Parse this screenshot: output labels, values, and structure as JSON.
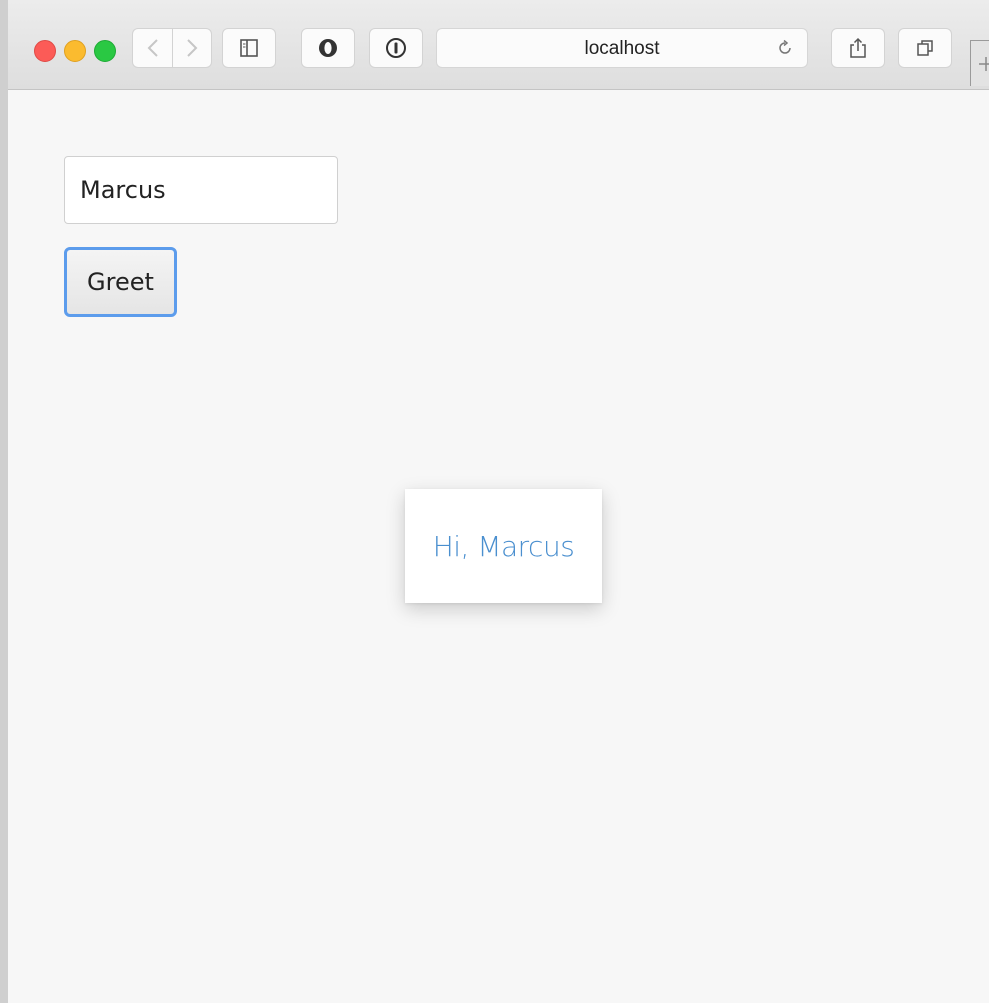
{
  "browser": {
    "address": "localhost",
    "traffic_lights": {
      "close": "#fc5b57",
      "minimize": "#fbbb2f",
      "maximize": "#2ac843"
    },
    "toolbar_icons": [
      "back-icon",
      "forward-icon",
      "sidebar-icon",
      "opera-icon",
      "info-icon",
      "reload-icon",
      "share-icon",
      "tabs-icon",
      "plus-icon"
    ]
  },
  "page": {
    "name_input": {
      "value": "Marcus"
    },
    "greet_button": {
      "label": "Greet"
    },
    "greeting": {
      "text": "Hi, Marcus",
      "color": "#4a8fcf"
    }
  }
}
